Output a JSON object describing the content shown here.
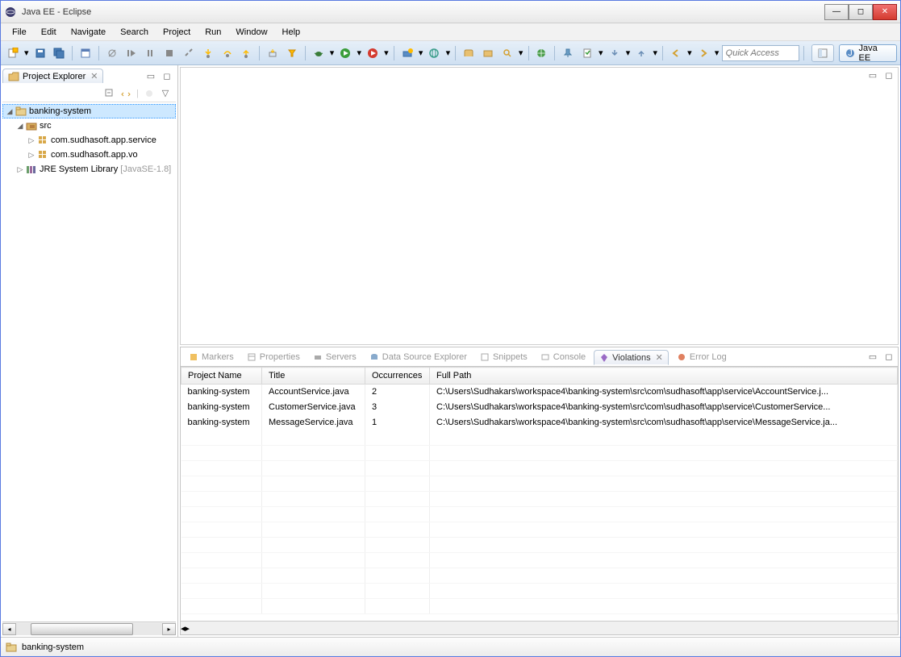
{
  "window": {
    "title": "Java EE - Eclipse"
  },
  "menu": {
    "items": [
      "File",
      "Edit",
      "Navigate",
      "Search",
      "Project",
      "Run",
      "Window",
      "Help"
    ]
  },
  "quick_access": {
    "placeholder": "Quick Access"
  },
  "perspective": {
    "label": "Java EE"
  },
  "project_explorer": {
    "title": "Project Explorer",
    "project": "banking-system",
    "src": "src",
    "pkg1": "com.sudhasoft.app.service",
    "pkg2": "com.sudhasoft.app.vo",
    "jre": "JRE System Library",
    "jre_suffix": "[JavaSE-1.8]"
  },
  "bottom_tabs": {
    "markers": "Markers",
    "properties": "Properties",
    "servers": "Servers",
    "dse": "Data Source Explorer",
    "snippets": "Snippets",
    "console": "Console",
    "violations": "Violations",
    "errorlog": "Error Log"
  },
  "table": {
    "headers": {
      "project": "Project Name",
      "title": "Title",
      "occ": "Occurrences",
      "path": "Full Path"
    },
    "rows": [
      {
        "project": "banking-system",
        "title": "AccountService.java",
        "occ": "2",
        "path": "C:\\Users\\Sudhakars\\workspace4\\banking-system\\src\\com\\sudhasoft\\app\\service\\AccountService.j..."
      },
      {
        "project": "banking-system",
        "title": "CustomerService.java",
        "occ": "3",
        "path": "C:\\Users\\Sudhakars\\workspace4\\banking-system\\src\\com\\sudhasoft\\app\\service\\CustomerService..."
      },
      {
        "project": "banking-system",
        "title": "MessageService.java",
        "occ": "1",
        "path": "C:\\Users\\Sudhakars\\workspace4\\banking-system\\src\\com\\sudhasoft\\app\\service\\MessageService.ja..."
      }
    ]
  },
  "status": {
    "text": "banking-system"
  }
}
